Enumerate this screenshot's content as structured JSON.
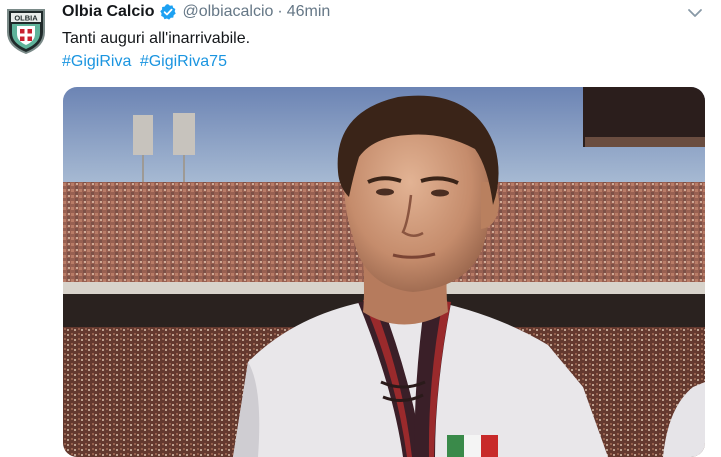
{
  "tweet": {
    "display_name": "Olbia Calcio",
    "handle": "@olbiacalcio",
    "separator": "·",
    "time": "46min",
    "text": "Tanti auguri all'inarrivabile.",
    "hashtags": [
      "#GigiRiva",
      "#GigiRiva75"
    ],
    "avatar_text": "OLBIA",
    "verified": true
  },
  "colors": {
    "hashtag": "#1b95e0",
    "verified": "#1da1f2",
    "secondary_text": "#657786"
  },
  "icons": {
    "avatar": "olbia-calcio-crest",
    "verified": "verified-badge-icon",
    "menu": "chevron-down-icon"
  }
}
